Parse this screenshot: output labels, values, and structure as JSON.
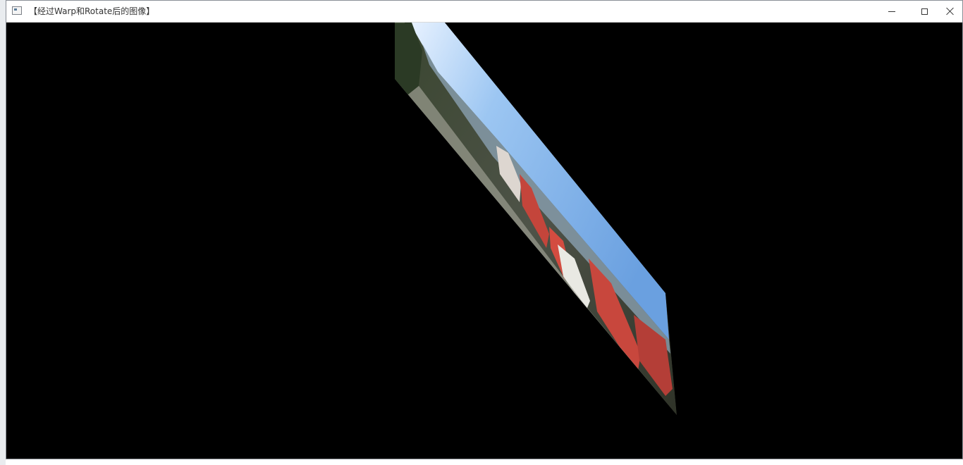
{
  "window": {
    "title": "【经过Warp和Rotate后的图像】"
  },
  "icons": {
    "app": "app-window-icon",
    "minimize": "minimize-icon",
    "maximize": "maximize-icon",
    "close": "close-icon"
  },
  "colors": {
    "canvas_background": "#000000",
    "sky": "#7fb2ea",
    "buildings": "#c5463c"
  }
}
